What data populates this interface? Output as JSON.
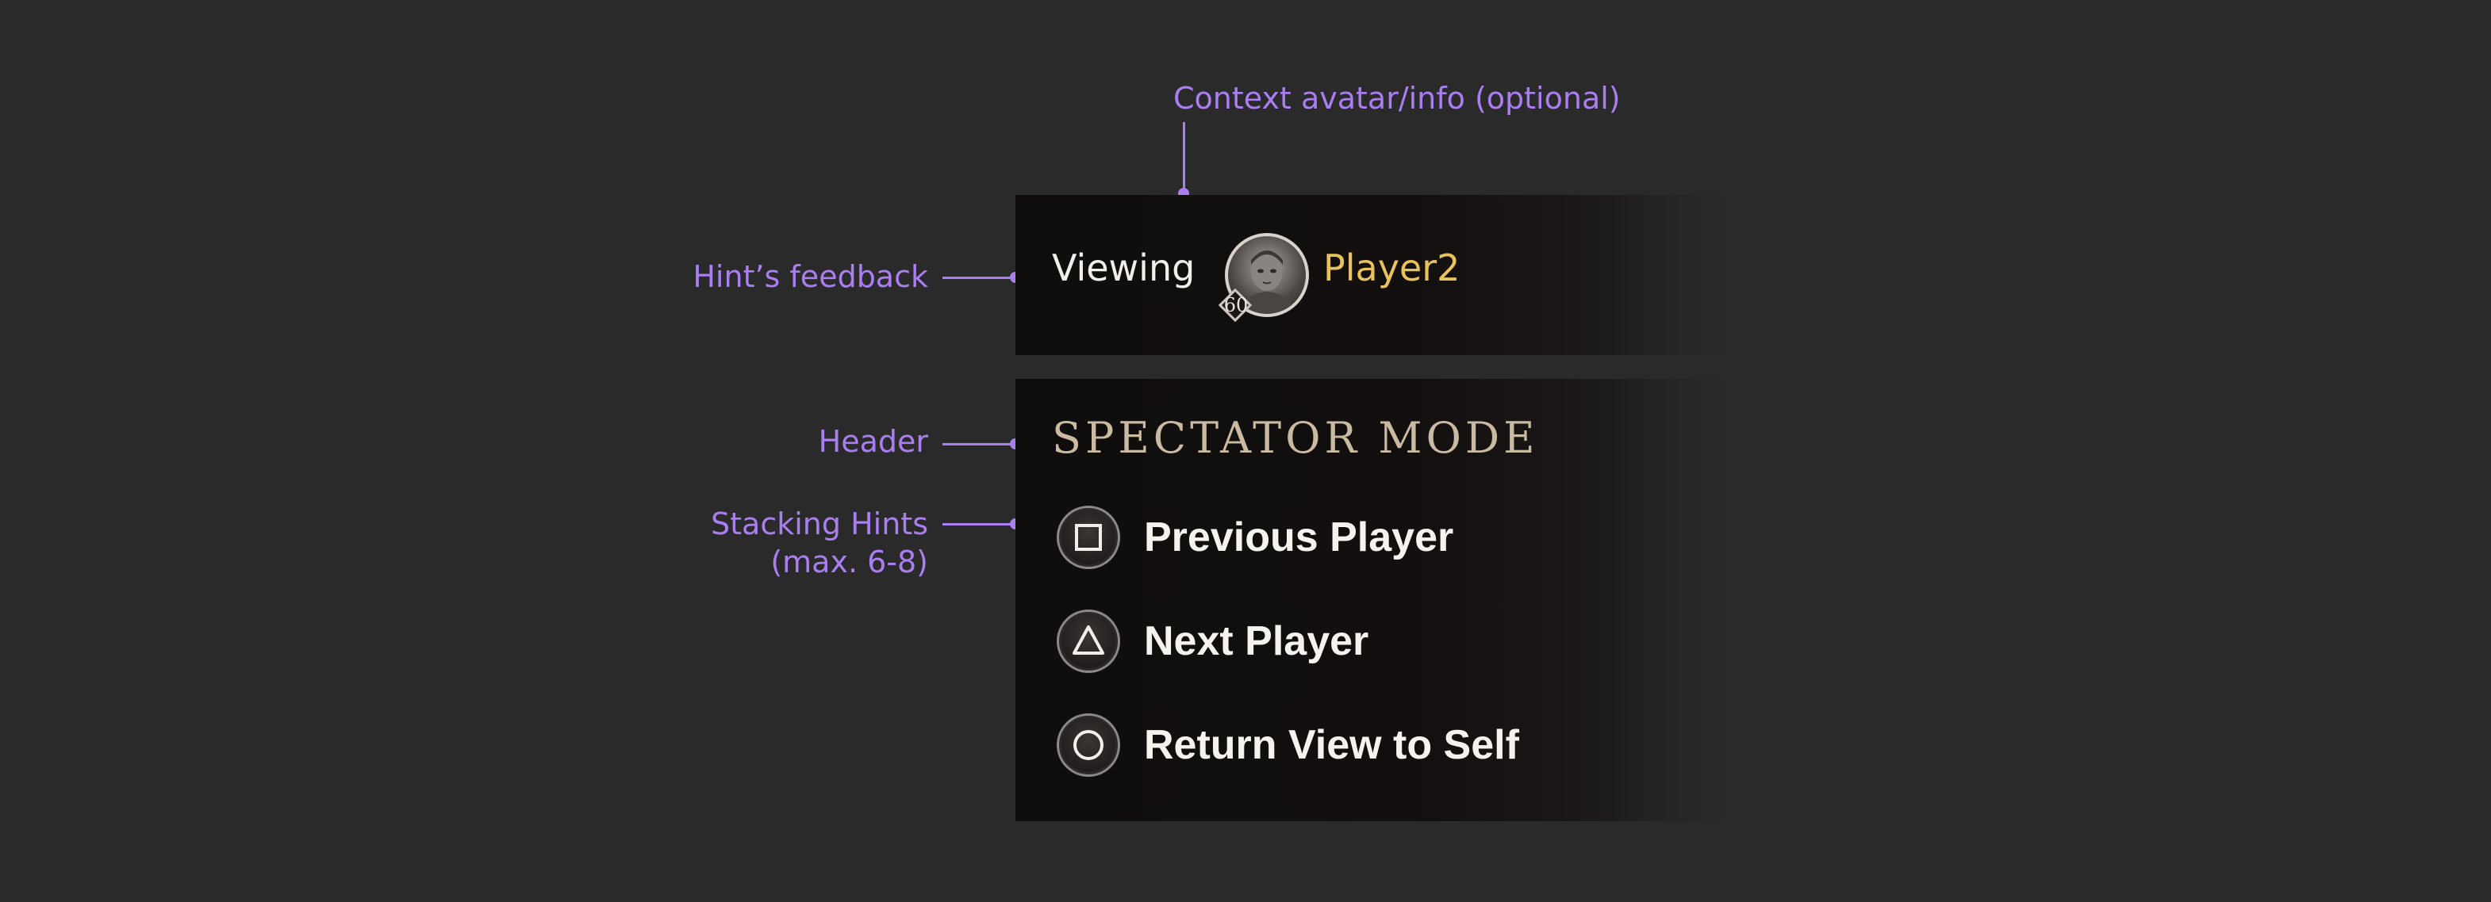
{
  "annotations": {
    "context": "Context avatar/info (optional)",
    "feedback": "Hint’s feedback",
    "header": "Header",
    "stacking_line1": "Stacking Hints",
    "stacking_line2": "(max. 6-8)"
  },
  "feedback": {
    "label": "Viewing",
    "player_name": "Player2",
    "level": "60"
  },
  "hints_panel": {
    "title": "SPECTATOR MODE",
    "hints": [
      {
        "icon": "square-button-icon",
        "label": "Previous Player"
      },
      {
        "icon": "triangle-button-icon",
        "label": "Next Player"
      },
      {
        "icon": "circle-button-icon",
        "label": "Return View to Self"
      }
    ]
  },
  "colors": {
    "background": "#2a2a2b",
    "annotation": "#a97ef0",
    "player_name": "#e8c25a",
    "header": "#c9baa1",
    "panel": "#100d0d"
  }
}
